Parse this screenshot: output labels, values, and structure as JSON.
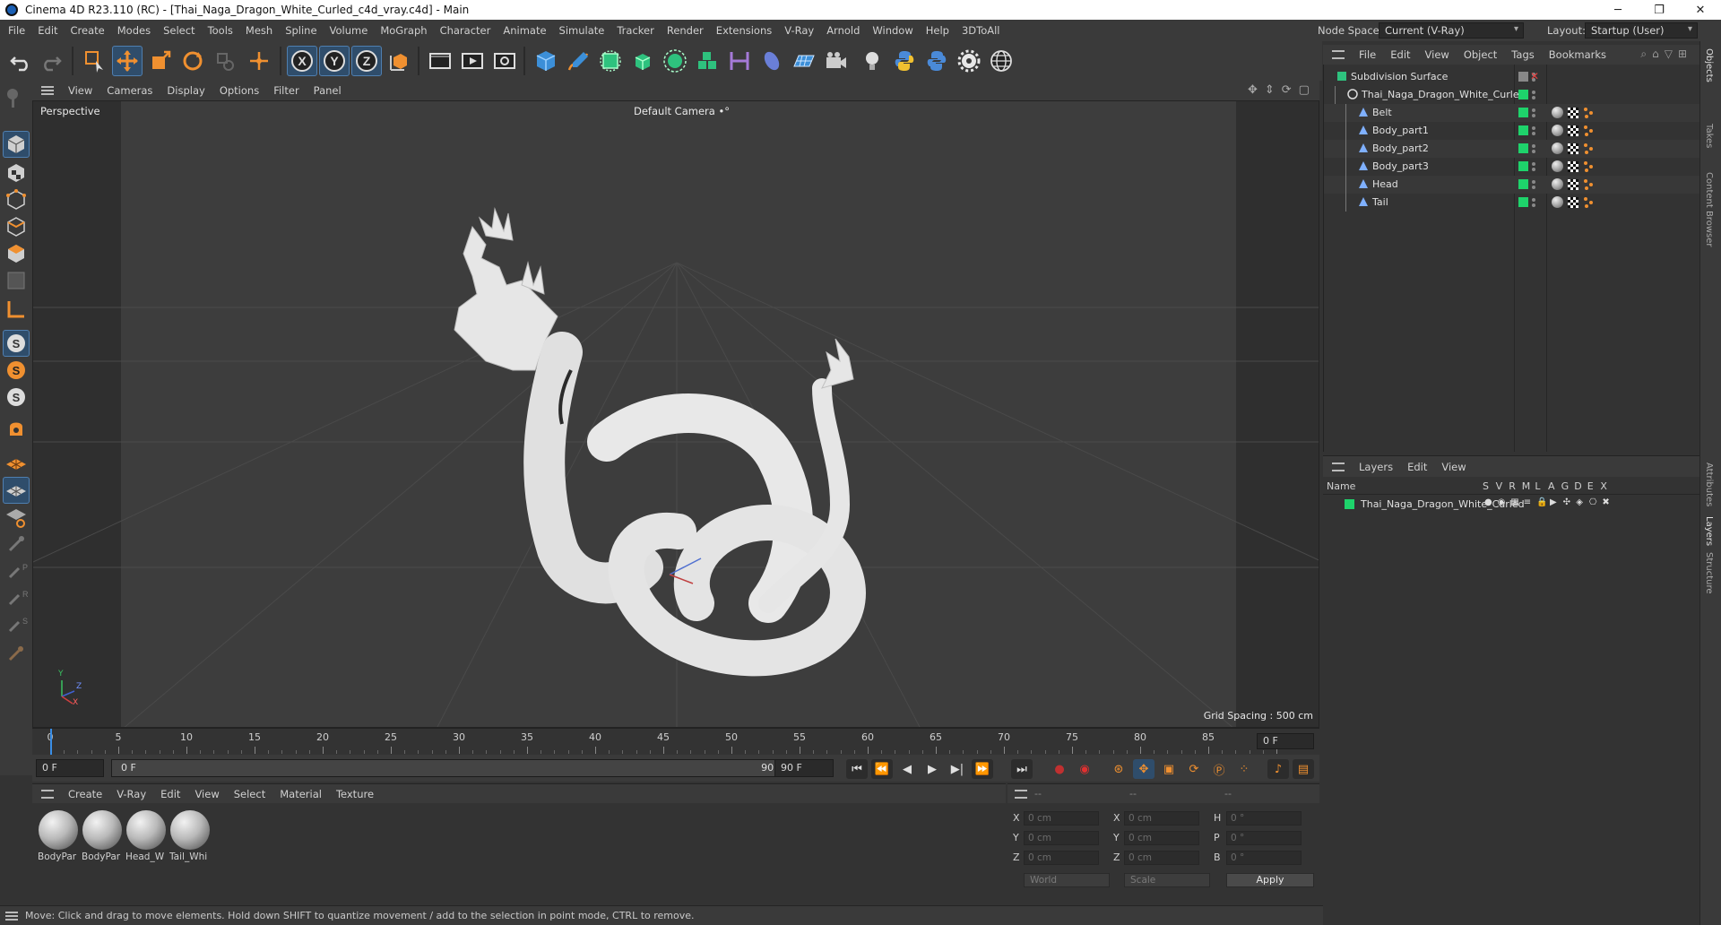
{
  "titlebar": {
    "title": "Cinema 4D R23.110 (RC) - [Thai_Naga_Dragon_White_Curled_c4d_vray.c4d] - Main",
    "minimize": "─",
    "maximize": "❐",
    "close": "✕"
  },
  "menubar": {
    "items": [
      "File",
      "Edit",
      "Create",
      "Modes",
      "Select",
      "Tools",
      "Mesh",
      "Spline",
      "Volume",
      "MoGraph",
      "Character",
      "Animate",
      "Simulate",
      "Tracker",
      "Render",
      "Extensions",
      "V-Ray",
      "Arnold",
      "Window",
      "Help",
      "3DToAll"
    ],
    "node_space_label": "Node Space:",
    "node_space_value": "Current (V-Ray)",
    "layout_label": "Layout:",
    "layout_value": "Startup (User)"
  },
  "viewport": {
    "menu": [
      "View",
      "Cameras",
      "Display",
      "Options",
      "Filter",
      "Panel"
    ],
    "view_name": "Perspective",
    "camera": "Default Camera",
    "camera_glyph": "•°",
    "grid_spacing": "Grid Spacing : 500 cm",
    "axis_y": "Y",
    "axis_z": "Z",
    "axis_x": "X"
  },
  "timeline": {
    "ticks": [
      "0",
      "5",
      "10",
      "15",
      "20",
      "25",
      "30",
      "35",
      "40",
      "45",
      "50",
      "55",
      "60",
      "65",
      "70",
      "75",
      "80",
      "85",
      "90"
    ],
    "current_frame": "0 F"
  },
  "playback": {
    "start_field": "0 F",
    "range_start": "0 F",
    "range_end": "90 F",
    "end_field": "90 F"
  },
  "material_manager": {
    "menu": [
      "Create",
      "V-Ray",
      "Edit",
      "View",
      "Select",
      "Material",
      "Texture"
    ],
    "materials": [
      "BodyPar",
      "BodyPar",
      "Head_W",
      "Tail_Whi"
    ]
  },
  "coordinates": {
    "header": [
      "--",
      "--",
      "--"
    ],
    "labels_pos": [
      "X",
      "Y",
      "Z"
    ],
    "labels_size": [
      "X",
      "Y",
      "Z"
    ],
    "labels_rot": [
      "H",
      "P",
      "B"
    ],
    "pos_values": [
      "0 cm",
      "0 cm",
      "0 cm"
    ],
    "size_values": [
      "0 cm",
      "0 cm",
      "0 cm"
    ],
    "rot_values": [
      "0 °",
      "0 °",
      "0 °"
    ],
    "space_dropdown": "World",
    "mode_dropdown": "Scale",
    "apply_label": "Apply"
  },
  "object_manager": {
    "menu": [
      "File",
      "Edit",
      "View",
      "Object",
      "Tags",
      "Bookmarks"
    ],
    "objects": [
      {
        "name": "Subdivision Surface",
        "indent": 0
      },
      {
        "name": "Thai_Naga_Dragon_White_Curled",
        "indent": 1
      },
      {
        "name": "Belt",
        "indent": 2
      },
      {
        "name": "Body_part1",
        "indent": 2
      },
      {
        "name": "Body_part2",
        "indent": 2
      },
      {
        "name": "Body_part3",
        "indent": 2
      },
      {
        "name": "Head",
        "indent": 2
      },
      {
        "name": "Tail",
        "indent": 2
      }
    ]
  },
  "layer_manager": {
    "menu": [
      "Layers",
      "Edit",
      "View"
    ],
    "columns": [
      "Name",
      "S",
      "V",
      "R",
      "M",
      "L",
      "A",
      "G",
      "D",
      "E",
      "X"
    ],
    "layers": [
      {
        "name": "Thai_Naga_Dragon_White_Curled",
        "color": "#1ed36b"
      }
    ]
  },
  "right_tabs": [
    "Objects",
    "Takes",
    "Content Browser",
    "Attributes",
    "Layers",
    "Structure"
  ],
  "status": {
    "message": "Move: Click and drag to move elements. Hold down SHIFT to quantize movement / add to the selection in point mode, CTRL to remove."
  },
  "colors": {
    "accent_blue": "#3a8ee6",
    "layer_green": "#1ed36b",
    "tag_orange": "#f09030"
  }
}
